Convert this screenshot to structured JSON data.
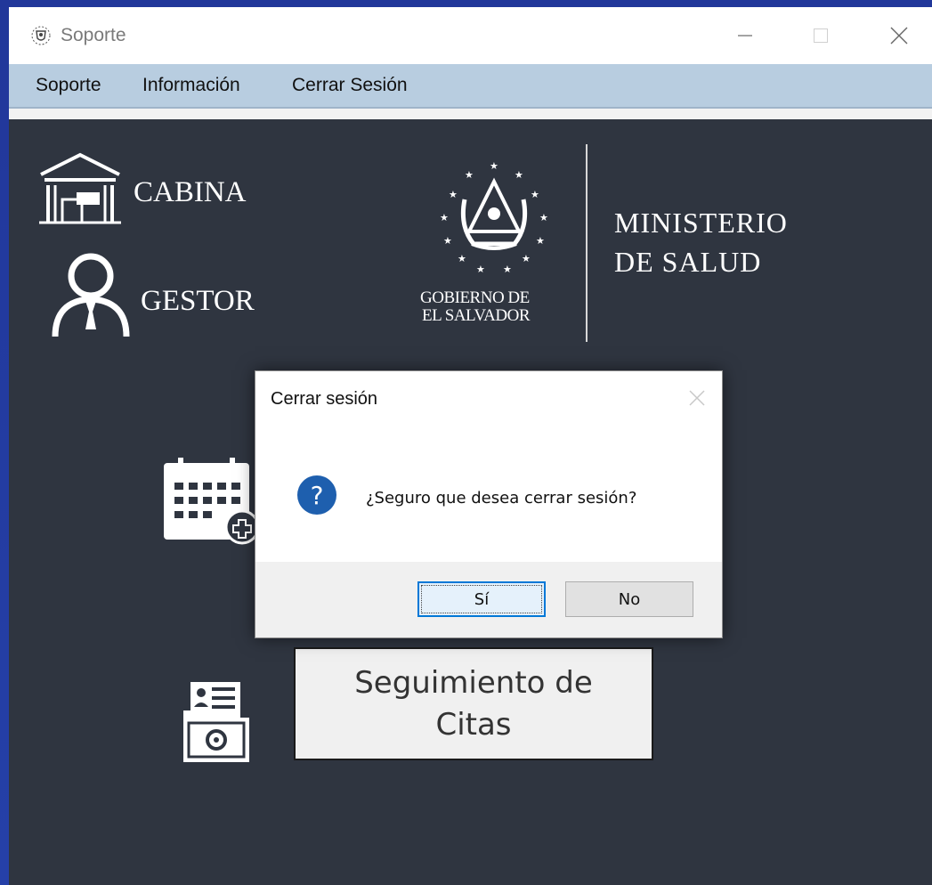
{
  "window": {
    "title": "Soporte",
    "icon": "salvador-shield-icon",
    "controls": [
      "minimize-icon",
      "maximize-icon",
      "close-icon"
    ]
  },
  "menu": {
    "items": [
      {
        "label": "Soporte"
      },
      {
        "label": "Información"
      },
      {
        "label": "Cerrar Sesión"
      }
    ]
  },
  "branding": {
    "cabina_label": "CABINA",
    "gestor_label": "GESTOR",
    "gobierno_line1": "GOBIERNO DE",
    "gobierno_line2": "EL SALVADOR",
    "ministerio_line1": "MINISTERIO",
    "ministerio_line2": "DE SALUD"
  },
  "main": {
    "seguimiento_line1": "Seguimiento de",
    "seguimiento_line2": "Citas"
  },
  "dialog": {
    "title": "Cerrar sesión",
    "message": "¿Seguro que desea cerrar sesión?",
    "yes_label": "Sí",
    "no_label": "No",
    "icon": "question-icon"
  },
  "colors": {
    "desktop": "#233a9a",
    "app_background": "#2f3540",
    "menubar": "#b8cde0",
    "dialog_icon": "#1e5fae",
    "focus_border": "#0078d7"
  }
}
